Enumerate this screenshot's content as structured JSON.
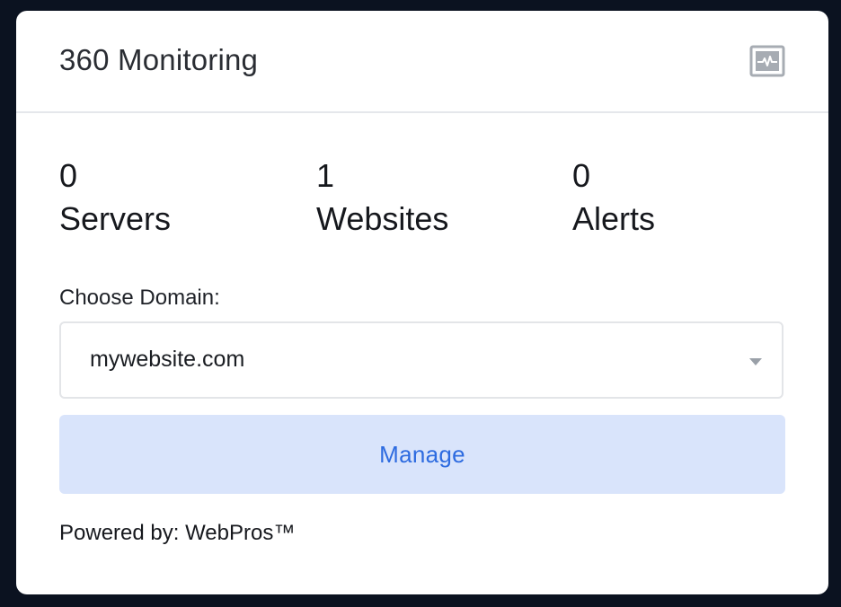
{
  "card": {
    "title": "360 Monitoring",
    "header_icon": "activity-monitor-icon"
  },
  "stats": [
    {
      "value": "0",
      "label": "Servers"
    },
    {
      "value": "1",
      "label": "Websites"
    },
    {
      "value": "0",
      "label": "Alerts"
    }
  ],
  "domain": {
    "label": "Choose Domain:",
    "selected": "mywebsite.com"
  },
  "actions": {
    "manage_label": "Manage"
  },
  "footer": {
    "powered_by": "Powered by: WebPros™"
  },
  "colors": {
    "page_background": "#0b1220",
    "card_background": "#ffffff",
    "button_background": "#d9e4fb",
    "button_text": "#2d6be0",
    "icon_gray": "#a7acb3"
  }
}
